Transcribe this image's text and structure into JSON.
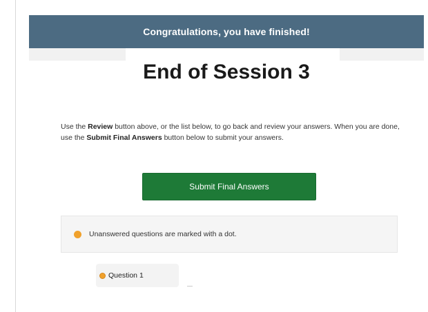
{
  "banner": {
    "text": "Congratulations, you have finished!"
  },
  "page": {
    "title": "End of Session 3"
  },
  "instructions": {
    "part1": "Use the ",
    "review_bold": "Review",
    "part2": " button above, or the list below, to go back and review your answers. When you are done, use the ",
    "submit_bold": "Submit Final Answers",
    "part3": " button below to submit your answers."
  },
  "submit_button": {
    "label": "Submit Final Answers"
  },
  "notice": {
    "text": "Unanswered questions are marked with a dot."
  },
  "questions": [
    {
      "label": "Question 1",
      "answered": false
    }
  ],
  "colors": {
    "banner": "#4c6b82",
    "submit": "#1e7a37",
    "unanswered_dot": "#f0a12c"
  }
}
